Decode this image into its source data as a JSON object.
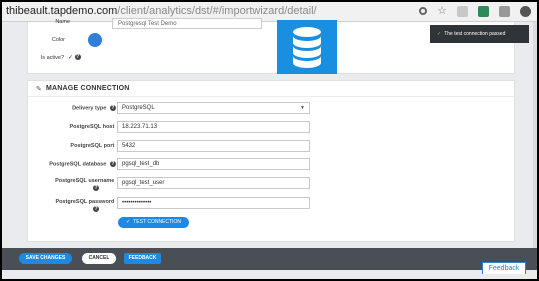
{
  "browser": {
    "url_host": "thibeault.tapdemo.com",
    "url_path": "/client/analytics/dst/#/importwizard/detail/"
  },
  "general": {
    "name_label": "Name",
    "name_value": "Postgresql Test Demo",
    "color_label": "Color",
    "color_value": "#2f7fd8",
    "active_label": "Is active?",
    "active_value": "✓",
    "help_glyph": "?"
  },
  "connection": {
    "section_title": "MANAGE CONNECTION",
    "delivery_type_label": "Delivery type",
    "delivery_type_value": "PostgreSQL",
    "host_label": "PostgreSQL host",
    "host_value": "18.223.71.13",
    "port_label": "PostgreSQL port",
    "port_value": "5432",
    "database_label": "PostgreSQL database",
    "database_value": "pgsql_test_db",
    "username_label": "PostgreSQL username",
    "username_value": "pgsql_test_user",
    "password_label": "PostgreSQL password",
    "password_value": "••••••••••••••",
    "required_mark": "*",
    "help_glyph": "?",
    "test_button": "TEST CONNECTION"
  },
  "actions": {
    "save_label": "SAVE CHANGES",
    "cancel_label": "CANCEL",
    "feedback_label": "FEEDBACK"
  },
  "feedback_tab": "Feedback",
  "toast": {
    "message": "The test connection passed"
  },
  "colors": {
    "accent": "#1e88e5",
    "toast_bg": "#2f3438",
    "bar_bg": "#4a4f56"
  }
}
